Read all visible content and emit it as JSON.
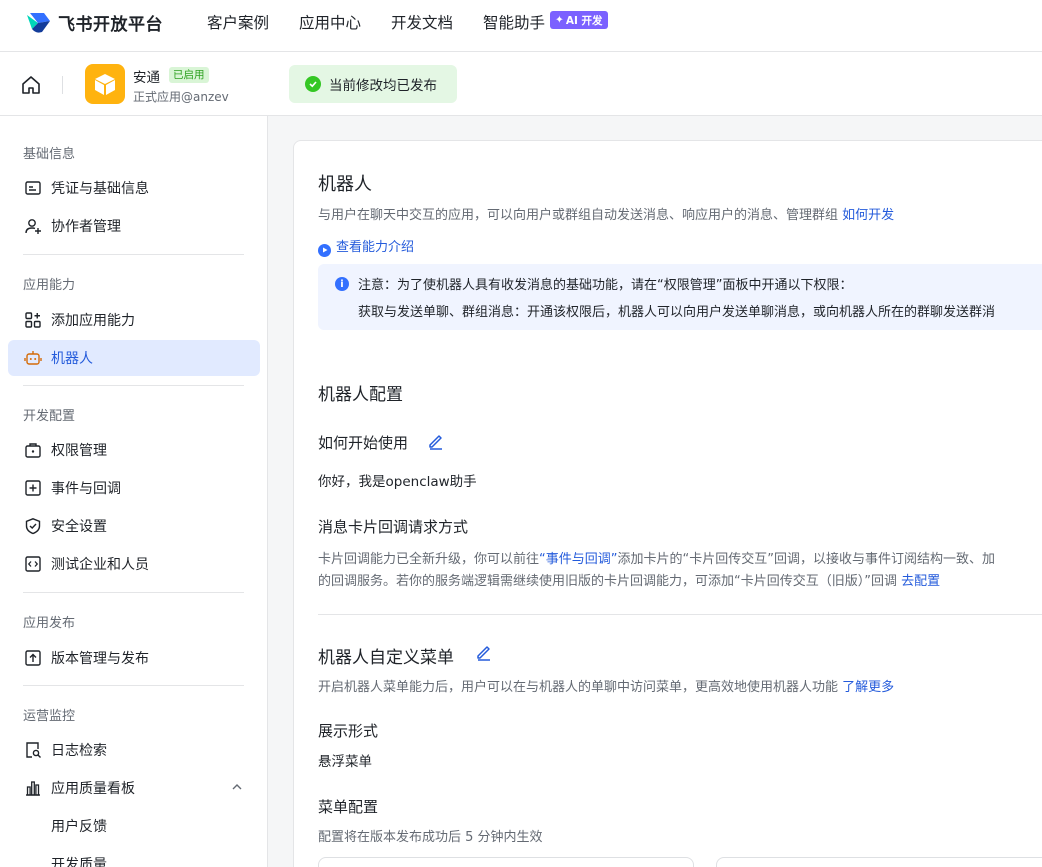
{
  "topnav": {
    "brand": "飞书开放平台",
    "items": [
      "客户案例",
      "应用中心",
      "开发文档",
      "智能助手"
    ],
    "ai_badge": "AI 开发"
  },
  "app": {
    "name": "安通",
    "status": "已启用",
    "subtitle": "正式应用@anzev",
    "publish_notice": "当前修改均已发布"
  },
  "sidebar": {
    "groups": {
      "basic": "基础信息",
      "capability": "应用能力",
      "dev": "开发配置",
      "release": "应用发布",
      "ops": "运营监控"
    },
    "items": {
      "credentials": "凭证与基础信息",
      "collaborators": "协作者管理",
      "add_capability": "添加应用能力",
      "bot": "机器人",
      "permissions": "权限管理",
      "events": "事件与回调",
      "security": "安全设置",
      "test_enterprise": "测试企业和人员",
      "versions": "版本管理与发布",
      "logs": "日志检索",
      "quality_board": "应用质量看板",
      "user_feedback": "用户反馈",
      "dev_quality": "开发质量"
    }
  },
  "main": {
    "title": "机器人",
    "description": "与用户在聊天中交互的应用，可以向用户或群组自动发送消息、响应用户的消息、管理群组",
    "how_to_dev": "如何开发",
    "view_intro": "查看能力介绍",
    "notice_line1": "注意：为了使机器人具有收发消息的基础功能，请在“权限管理”面板中开通以下权限：",
    "notice_line2": "获取与发送单聊、群组消息：开通该权限后，机器人可以向用户发送单聊消息，或向机器人所在的群聊发送群消",
    "config_title": "机器人配置",
    "how_to_start": "如何开始使用",
    "greeting": "你好，我是openclaw助手",
    "card_callback_title": "消息卡片回调请求方式",
    "card_callback_desc1_a": "卡片回调能力已全新升级，你可以前往",
    "card_callback_desc1_link": "“事件与回调”",
    "card_callback_desc1_b": "添加卡片的“卡片回传交互”回调，以接收与事件订阅结构一致、加",
    "card_callback_desc2": "的回调服务。若你的服务端逻辑需继续使用旧版的卡片回调能力，可添加“卡片回传交互（旧版）”回调",
    "go_config": "去配置",
    "menu_title": "机器人自定义菜单",
    "menu_desc": "开启机器人菜单能力后，用户可以在与机器人的单聊中访问菜单，更高效地使用机器人功能",
    "learn_more": "了解更多",
    "display_form_label": "展示形式",
    "display_form_value": "悬浮菜单",
    "menu_config_label": "菜单配置",
    "menu_config_desc": "配置将在版本发布成功后 5 分钟内生效"
  }
}
